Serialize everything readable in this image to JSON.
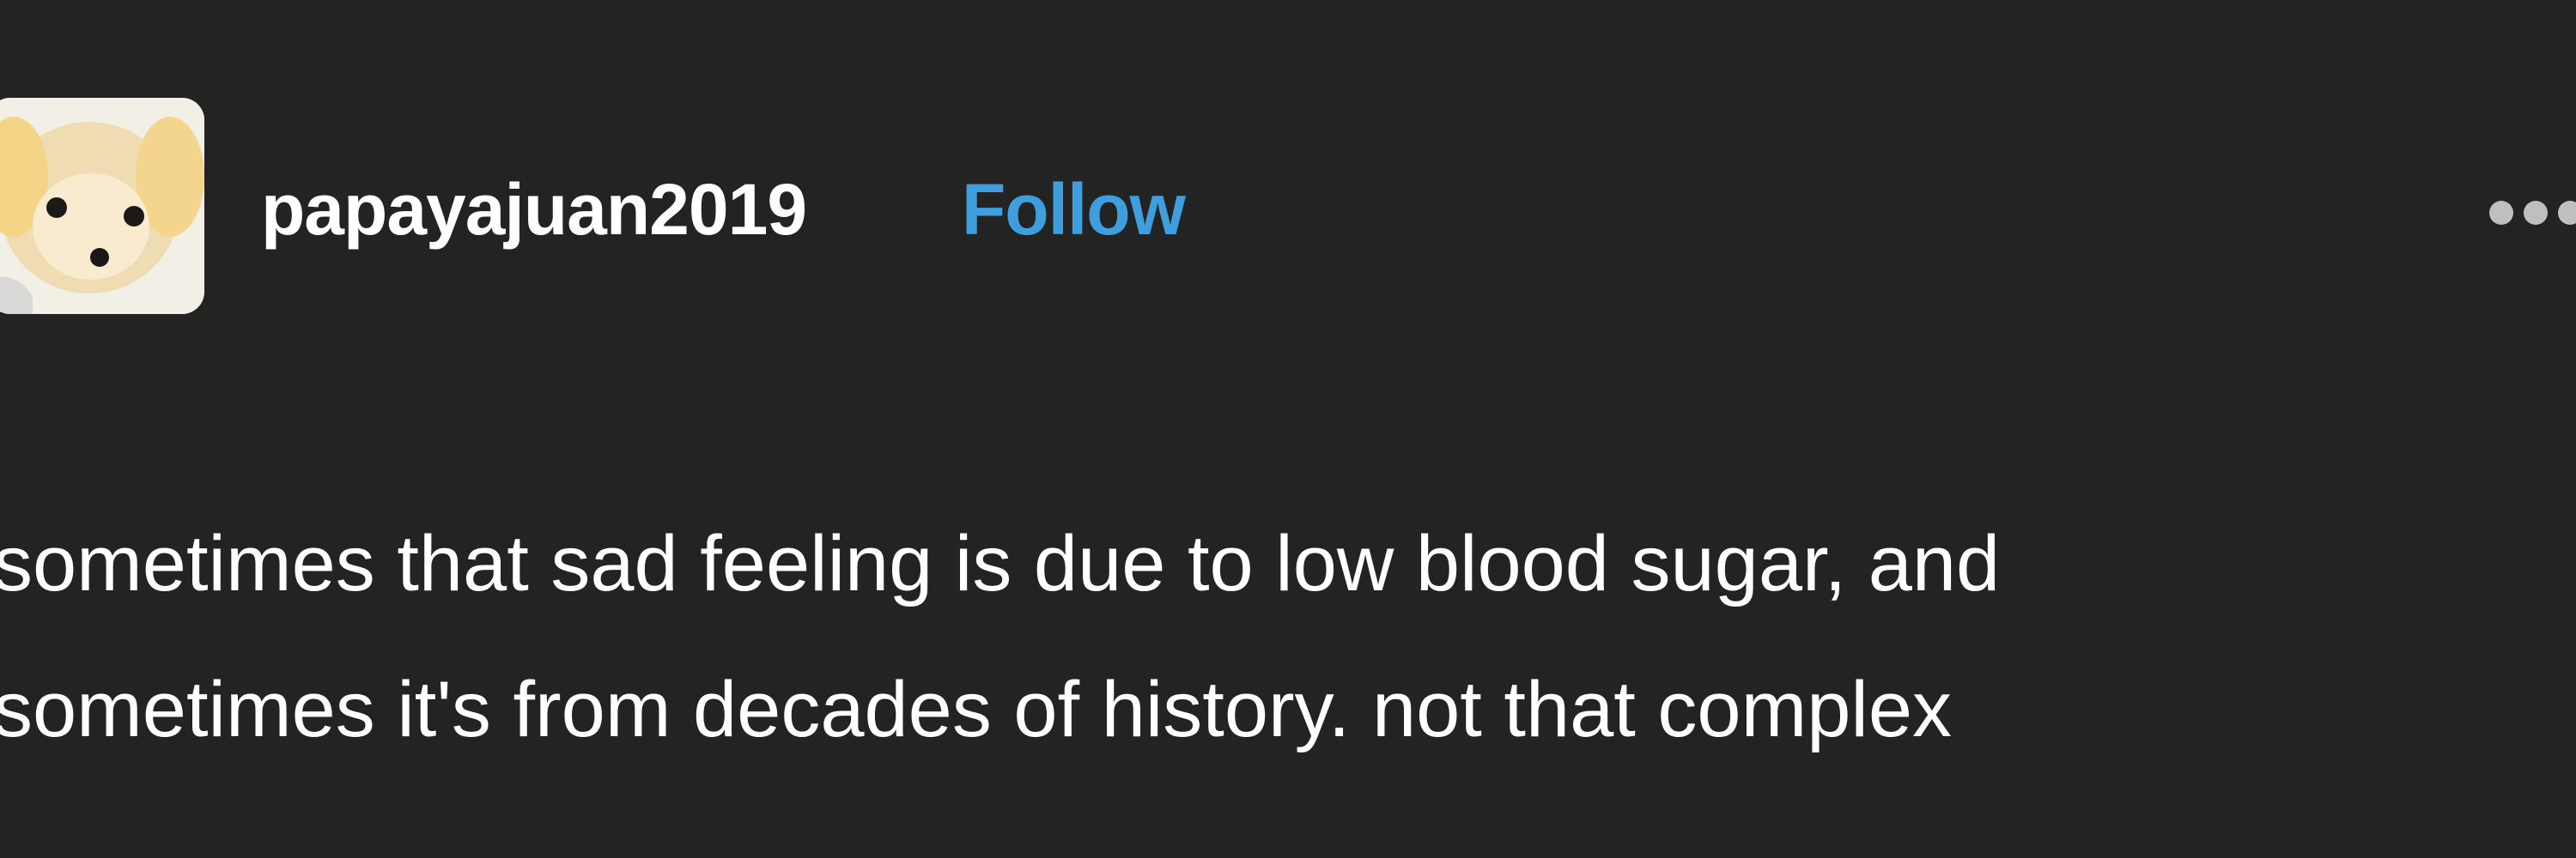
{
  "post": {
    "username": "papayajuan2019",
    "follow_label": "Follow",
    "avatar_icon": "dog-avatar-icon",
    "more_icon": "more-options-icon",
    "body_lines": [
      "sometimes that sad feeling is due to low blood sugar, and",
      "sometimes it's from decades of history. not that complex"
    ]
  },
  "colors": {
    "background": "#232323",
    "text": "#ffffff",
    "accent": "#3f9fde"
  }
}
